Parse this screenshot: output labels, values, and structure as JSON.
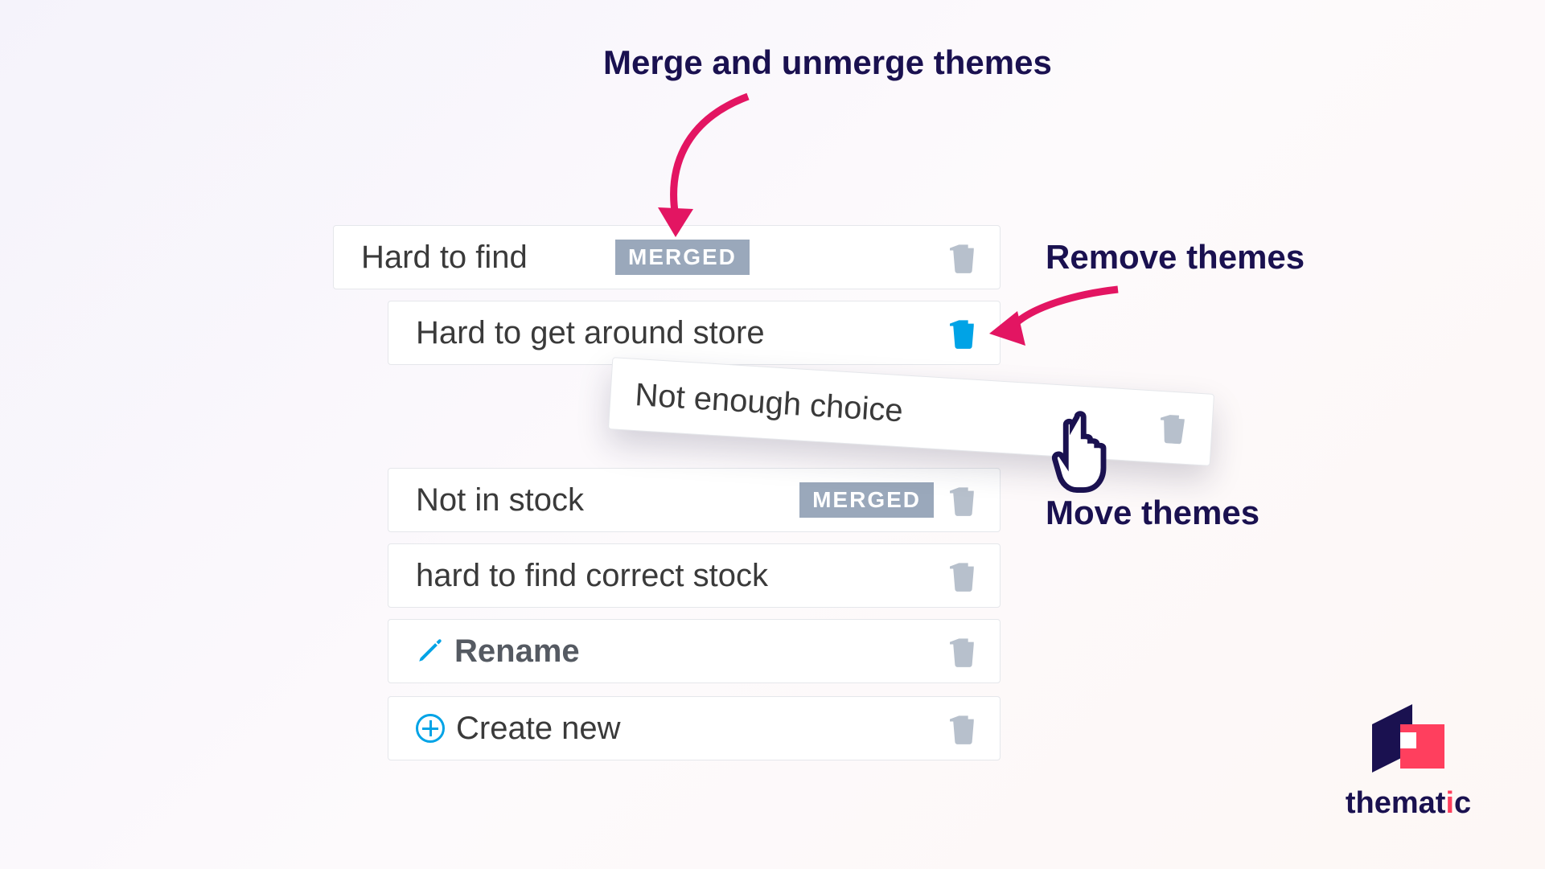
{
  "callouts": {
    "merge": "Merge and unmerge themes",
    "remove": "Remove themes",
    "move": "Move themes"
  },
  "themes": {
    "row0": {
      "label": "Hard to find",
      "badge": "MERGED"
    },
    "row1": {
      "label": "Hard to get around store"
    },
    "dragging": {
      "label": "Not enough choice"
    },
    "row3": {
      "label": "Not in stock",
      "badge": "MERGED"
    },
    "row4": {
      "label": "hard to find correct stock"
    },
    "rename": {
      "label": "Rename"
    },
    "create": {
      "label": "Create new"
    }
  },
  "logo": {
    "text_prefix": "themat",
    "text_accent": "i",
    "text_suffix": "c"
  },
  "colors": {
    "brand_dark": "#1a1150",
    "brand_blue": "#00a3e6",
    "brand_pink": "#e31562",
    "muted": "#b7c0cc"
  }
}
